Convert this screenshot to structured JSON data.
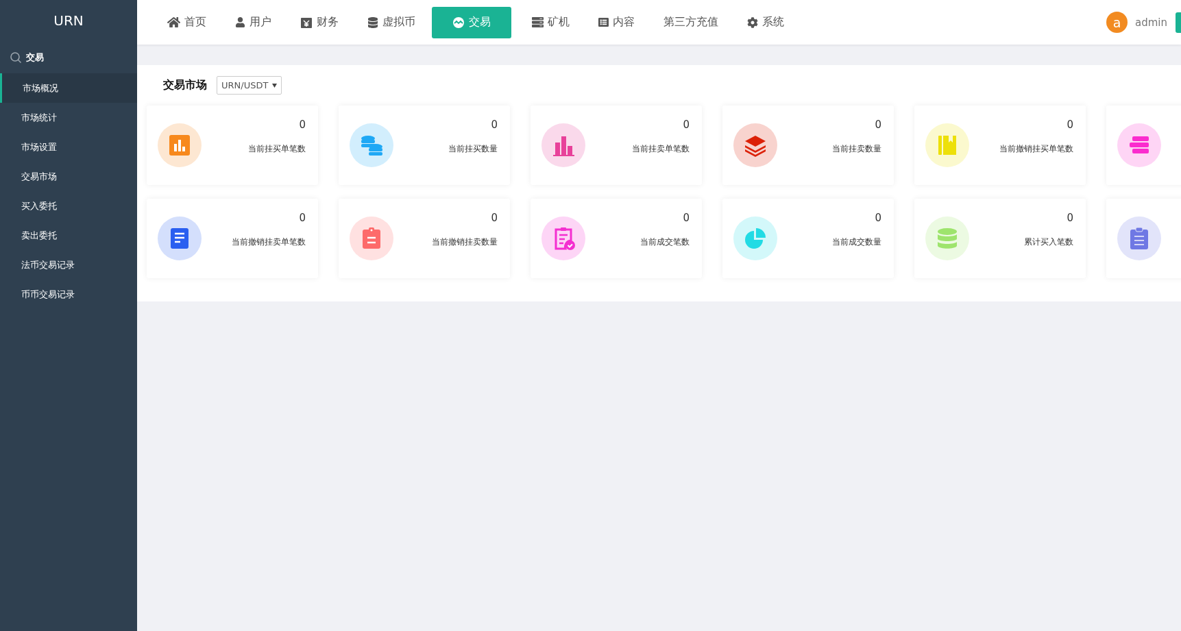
{
  "sidebar": {
    "brand": "URN",
    "section": "交易",
    "items": [
      {
        "label": "市场概况",
        "selected": true
      },
      {
        "label": "市场统计",
        "selected": false
      },
      {
        "label": "市场设置",
        "selected": false
      },
      {
        "label": "交易市场",
        "selected": false
      },
      {
        "label": "买入委托",
        "selected": false
      },
      {
        "label": "卖出委托",
        "selected": false
      },
      {
        "label": "法币交易记录",
        "selected": false
      },
      {
        "label": "币币交易记录",
        "selected": false
      }
    ]
  },
  "nav": {
    "items": [
      {
        "label": "首页",
        "kind": "home",
        "selected": false
      },
      {
        "label": "用户",
        "kind": "user",
        "selected": false
      },
      {
        "label": "财务",
        "kind": "yen",
        "selected": false
      },
      {
        "label": "虚拟币",
        "kind": "database",
        "selected": false
      },
      {
        "label": "交易",
        "kind": "wave",
        "selected": true
      },
      {
        "label": "矿机",
        "kind": "server",
        "selected": false
      },
      {
        "label": "内容",
        "kind": "list",
        "selected": false
      },
      {
        "label": "第三方充值",
        "kind": "plain",
        "selected": false
      },
      {
        "label": "系统",
        "kind": "gear",
        "selected": false
      }
    ],
    "user": {
      "avatar": "a",
      "name": "admin"
    }
  },
  "market": {
    "title": "交易市场",
    "pair": "URN/USDT",
    "cards": [
      {
        "kind": "bar-chart",
        "color": "#f7891d",
        "value": "0",
        "label": "当前挂买单笔数"
      },
      {
        "kind": "coins",
        "color": "#1fa8f5",
        "value": "0",
        "label": "当前挂买数量"
      },
      {
        "kind": "columns",
        "color": "#e8419a",
        "value": "0",
        "label": "当前挂卖单笔数"
      },
      {
        "kind": "layers",
        "color": "#dc2108",
        "value": "0",
        "label": "当前挂卖数量"
      },
      {
        "kind": "book",
        "color": "#ede00a",
        "value": "0",
        "label": "当前撤销挂买单笔数"
      },
      {
        "kind": "stack",
        "color": "#fb2cce"
      },
      {
        "kind": "document",
        "color": "#2a5ff0",
        "value": "0",
        "label": "当前撤销挂卖单笔数"
      },
      {
        "kind": "clipboard",
        "color": "#fd6a6a",
        "value": "0",
        "label": "当前撤销挂卖数量"
      },
      {
        "kind": "clipboard-check",
        "color": "#f42fd0",
        "value": "0",
        "label": "当前成交笔数"
      },
      {
        "kind": "pie",
        "color": "#22dbe4",
        "value": "0",
        "label": "当前成交数量"
      },
      {
        "kind": "database",
        "color": "#9ee46d",
        "value": "0",
        "label": "累计买入笔数"
      },
      {
        "kind": "clipboard-list",
        "color": "#6f78e4"
      }
    ]
  }
}
